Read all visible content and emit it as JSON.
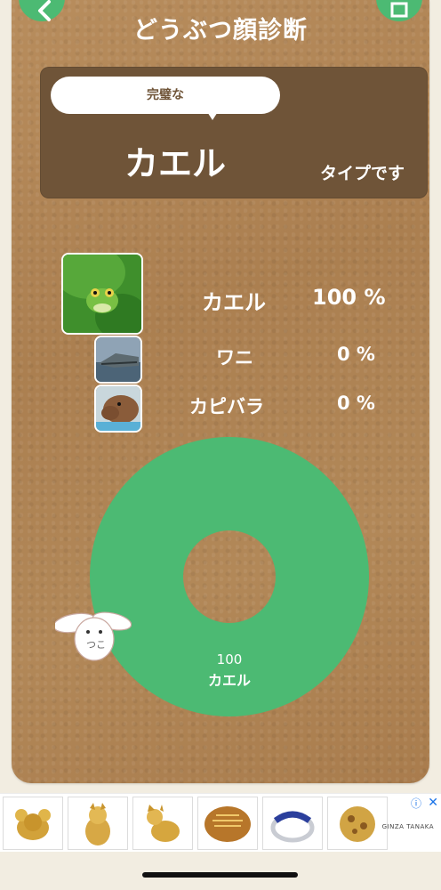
{
  "header": {
    "title": "どうぶつ顔診断",
    "back_icon": "chevron-left-icon",
    "share_icon": "share-icon"
  },
  "result": {
    "bubble_text": "完璧な",
    "animal": "カエル",
    "suffix": "タイプです"
  },
  "ranking": [
    {
      "name": "カエル",
      "percent": "100 %",
      "image": "frog-photo"
    },
    {
      "name": "ワニ",
      "percent": "0 %",
      "image": "crocodile-photo"
    },
    {
      "name": "カピバラ",
      "percent": "0 %",
      "image": "capybara-photo"
    }
  ],
  "chart_data": {
    "type": "pie",
    "categories": [
      "カエル"
    ],
    "values": [
      100
    ],
    "data_labels": [
      "100"
    ],
    "colors": [
      "#4cba73"
    ]
  },
  "ad": {
    "brand": "GINZA TANAKA",
    "info_icon": "info-icon",
    "close_icon": "close-icon",
    "items": [
      "mouse-figurine",
      "dog-figurine",
      "cat-figurine",
      "gold-bread",
      "sapphire-ring",
      "gold-ornament"
    ]
  },
  "colors": {
    "accent": "#4cba73",
    "card": "#ab7f50",
    "result_box": "#6f5438"
  }
}
